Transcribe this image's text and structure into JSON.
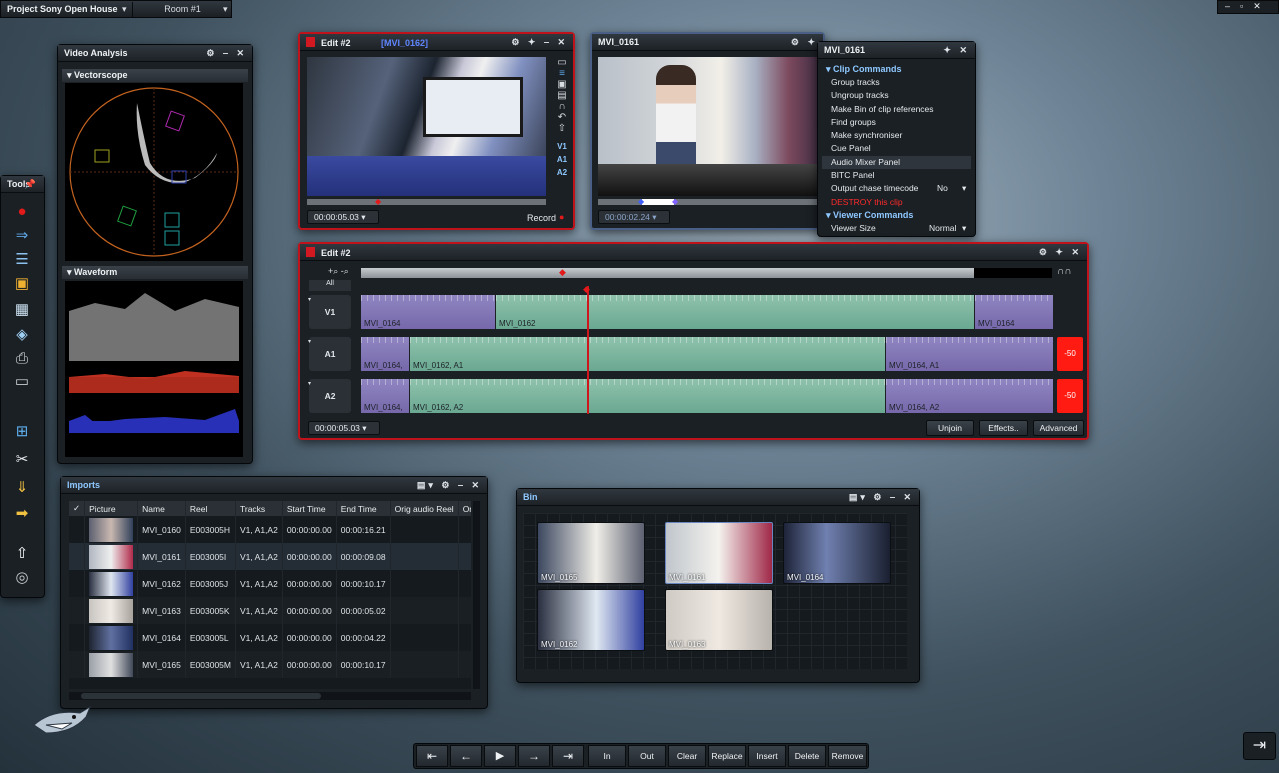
{
  "topbar": {
    "project": "Project Sony Open House",
    "room": "Room #1"
  },
  "video_analysis": {
    "title": "Video Analysis",
    "vectorscope": "Vectorscope",
    "waveform": "Waveform"
  },
  "tools": {
    "title": "Tools",
    "items": [
      "record-icon",
      "import-arrow-icon",
      "timeline-icon",
      "folder-icon",
      "grid-icon",
      "cube-icon",
      "printer-icon",
      "drive-icon",
      "calculator-icon",
      "scissors-icon",
      "export-icon",
      "exit-arrow-icon",
      "home-arrow-icon",
      "fingerprint-icon"
    ]
  },
  "edit_viewer": {
    "title": "Edit #2",
    "clip": "[MVI_0162]",
    "timecode": "00:00:05.03",
    "record_label": "Record",
    "tracks": [
      "V1",
      "A1",
      "A2"
    ]
  },
  "source_viewer": {
    "title": "MVI_0161",
    "timecode": "00:00:02.24"
  },
  "clip_menu": {
    "title": "MVI_0161",
    "clip_commands": "Clip Commands",
    "items": [
      "Group tracks",
      "Ungroup tracks",
      "Make Bin of clip references",
      "Find groups",
      "Make synchroniser",
      "Cue Panel",
      "Audio Mixer Panel",
      "BITC Panel"
    ],
    "output_chase": "Output chase timecode",
    "output_chase_value": "No",
    "destroy": "DESTROY this clip",
    "viewer_commands": "Viewer Commands",
    "viewer_size": "Viewer Size",
    "viewer_size_value": "Normal",
    "colors": {
      "header": "#8ec8ff",
      "destroy": "#ff2a2a"
    }
  },
  "timeline": {
    "title": "Edit #2",
    "zoom_all": "All",
    "timecode": "00:00:05.03",
    "buttons": {
      "unjoin": "Unjoin",
      "effects": "Effects..",
      "advanced": "Advanced"
    },
    "tracks": [
      {
        "name": "V1",
        "segments": [
          "MVI_0164",
          "MVI_0162",
          "MVI_0164"
        ]
      },
      {
        "name": "A1",
        "segments": [
          "MVI_0164,",
          "MVI_0162, A1",
          "MVI_0164, A1"
        ],
        "level": "-50"
      },
      {
        "name": "A2",
        "segments": [
          "MVI_0164,",
          "MVI_0162, A2",
          "MVI_0164, A2"
        ],
        "level": "-50"
      }
    ]
  },
  "imports": {
    "title": "Imports",
    "columns": [
      "✓",
      "Picture",
      "Name",
      "Reel",
      "Tracks",
      "Start Time",
      "End Time",
      "Orig audio Reel",
      "Orig"
    ],
    "rows": [
      {
        "name": "MVI_0160",
        "reel": "E003005H",
        "tracks": "V1, A1,A2",
        "start": "00:00:00.00",
        "end": "00:00:16.21"
      },
      {
        "name": "MVI_0161",
        "reel": "E003005I",
        "tracks": "V1, A1,A2",
        "start": "00:00:00.00",
        "end": "00:00:09.08"
      },
      {
        "name": "MVI_0162",
        "reel": "E003005J",
        "tracks": "V1, A1,A2",
        "start": "00:00:00.00",
        "end": "00:00:10.17"
      },
      {
        "name": "MVI_0163",
        "reel": "E003005K",
        "tracks": "V1, A1,A2",
        "start": "00:00:00.00",
        "end": "00:00:05.02"
      },
      {
        "name": "MVI_0164",
        "reel": "E003005L",
        "tracks": "V1, A1,A2",
        "start": "00:00:00.00",
        "end": "00:00:04.22"
      },
      {
        "name": "MVI_0165",
        "reel": "E003005M",
        "tracks": "V1, A1,A2",
        "start": "00:00:00.00",
        "end": "00:00:10.17"
      }
    ]
  },
  "bin": {
    "title": "Bin",
    "items": [
      "MVI_0165",
      "MVI_0161",
      "MVI_0164",
      "MVI_0162",
      "MVI_0163"
    ]
  },
  "transport": {
    "buttons": [
      "⇤",
      "←",
      "▶",
      "→",
      "⇥"
    ],
    "in": "In",
    "out": "Out",
    "clear": "Clear",
    "replace": "Replace",
    "insert": "Insert",
    "delete": "Delete",
    "remove": "Remove"
  }
}
